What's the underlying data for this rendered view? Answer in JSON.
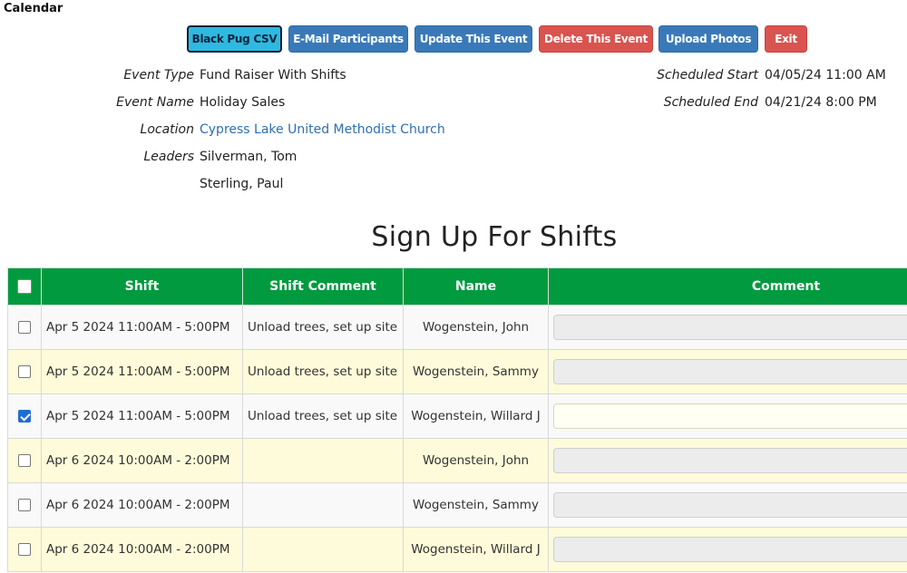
{
  "breadcrumb": "Calendar",
  "toolbar": {
    "buttons": [
      {
        "label": "Black Pug CSV",
        "color": "#2fb9e0"
      },
      {
        "label": "E-Mail Participants",
        "color": "#3a79b8"
      },
      {
        "label": "Update This Event",
        "color": "#3a79b8"
      },
      {
        "label": "Delete This Event",
        "color": "#d9534f"
      },
      {
        "label": "Upload Photos",
        "color": "#3a79b8"
      },
      {
        "label": "Exit",
        "color": "#d9534f"
      }
    ]
  },
  "event": {
    "type_label": "Event Type",
    "type": "Fund Raiser With Shifts",
    "name_label": "Event Name",
    "name": "Holiday Sales",
    "location_label": "Location",
    "location": "Cypress Lake United Methodist Church",
    "leaders_label": "Leaders",
    "leaders": [
      "Silverman, Tom",
      "Sterling, Paul"
    ],
    "start_label": "Scheduled Start",
    "start": "04/05/24 11:00 AM",
    "end_label": "Scheduled End",
    "end": "04/21/24 8:00 PM"
  },
  "signup": {
    "title": "Sign Up For Shifts",
    "header_color": "#019a3e",
    "columns": [
      "Shift",
      "Shift Comment",
      "Name",
      "Comment"
    ],
    "rows": [
      {
        "checked": false,
        "shift": "Apr 5 2024 11:00AM - 5:00PM",
        "shift_comment": "Unload trees, set up site",
        "name": "Wogenstein, John",
        "comment": ""
      },
      {
        "checked": false,
        "shift": "Apr 5 2024 11:00AM - 5:00PM",
        "shift_comment": "Unload trees, set up site",
        "name": "Wogenstein, Sammy",
        "comment": ""
      },
      {
        "checked": true,
        "shift": "Apr 5 2024 11:00AM - 5:00PM",
        "shift_comment": "Unload trees, set up site",
        "name": "Wogenstein, Willard J",
        "comment": ""
      },
      {
        "checked": false,
        "shift": "Apr 6 2024 10:00AM - 2:00PM",
        "shift_comment": "",
        "name": "Wogenstein, John",
        "comment": ""
      },
      {
        "checked": false,
        "shift": "Apr 6 2024 10:00AM - 2:00PM",
        "shift_comment": "",
        "name": "Wogenstein, Sammy",
        "comment": ""
      },
      {
        "checked": false,
        "shift": "Apr 6 2024 10:00AM - 2:00PM",
        "shift_comment": "",
        "name": "Wogenstein, Willard J",
        "comment": ""
      }
    ]
  }
}
